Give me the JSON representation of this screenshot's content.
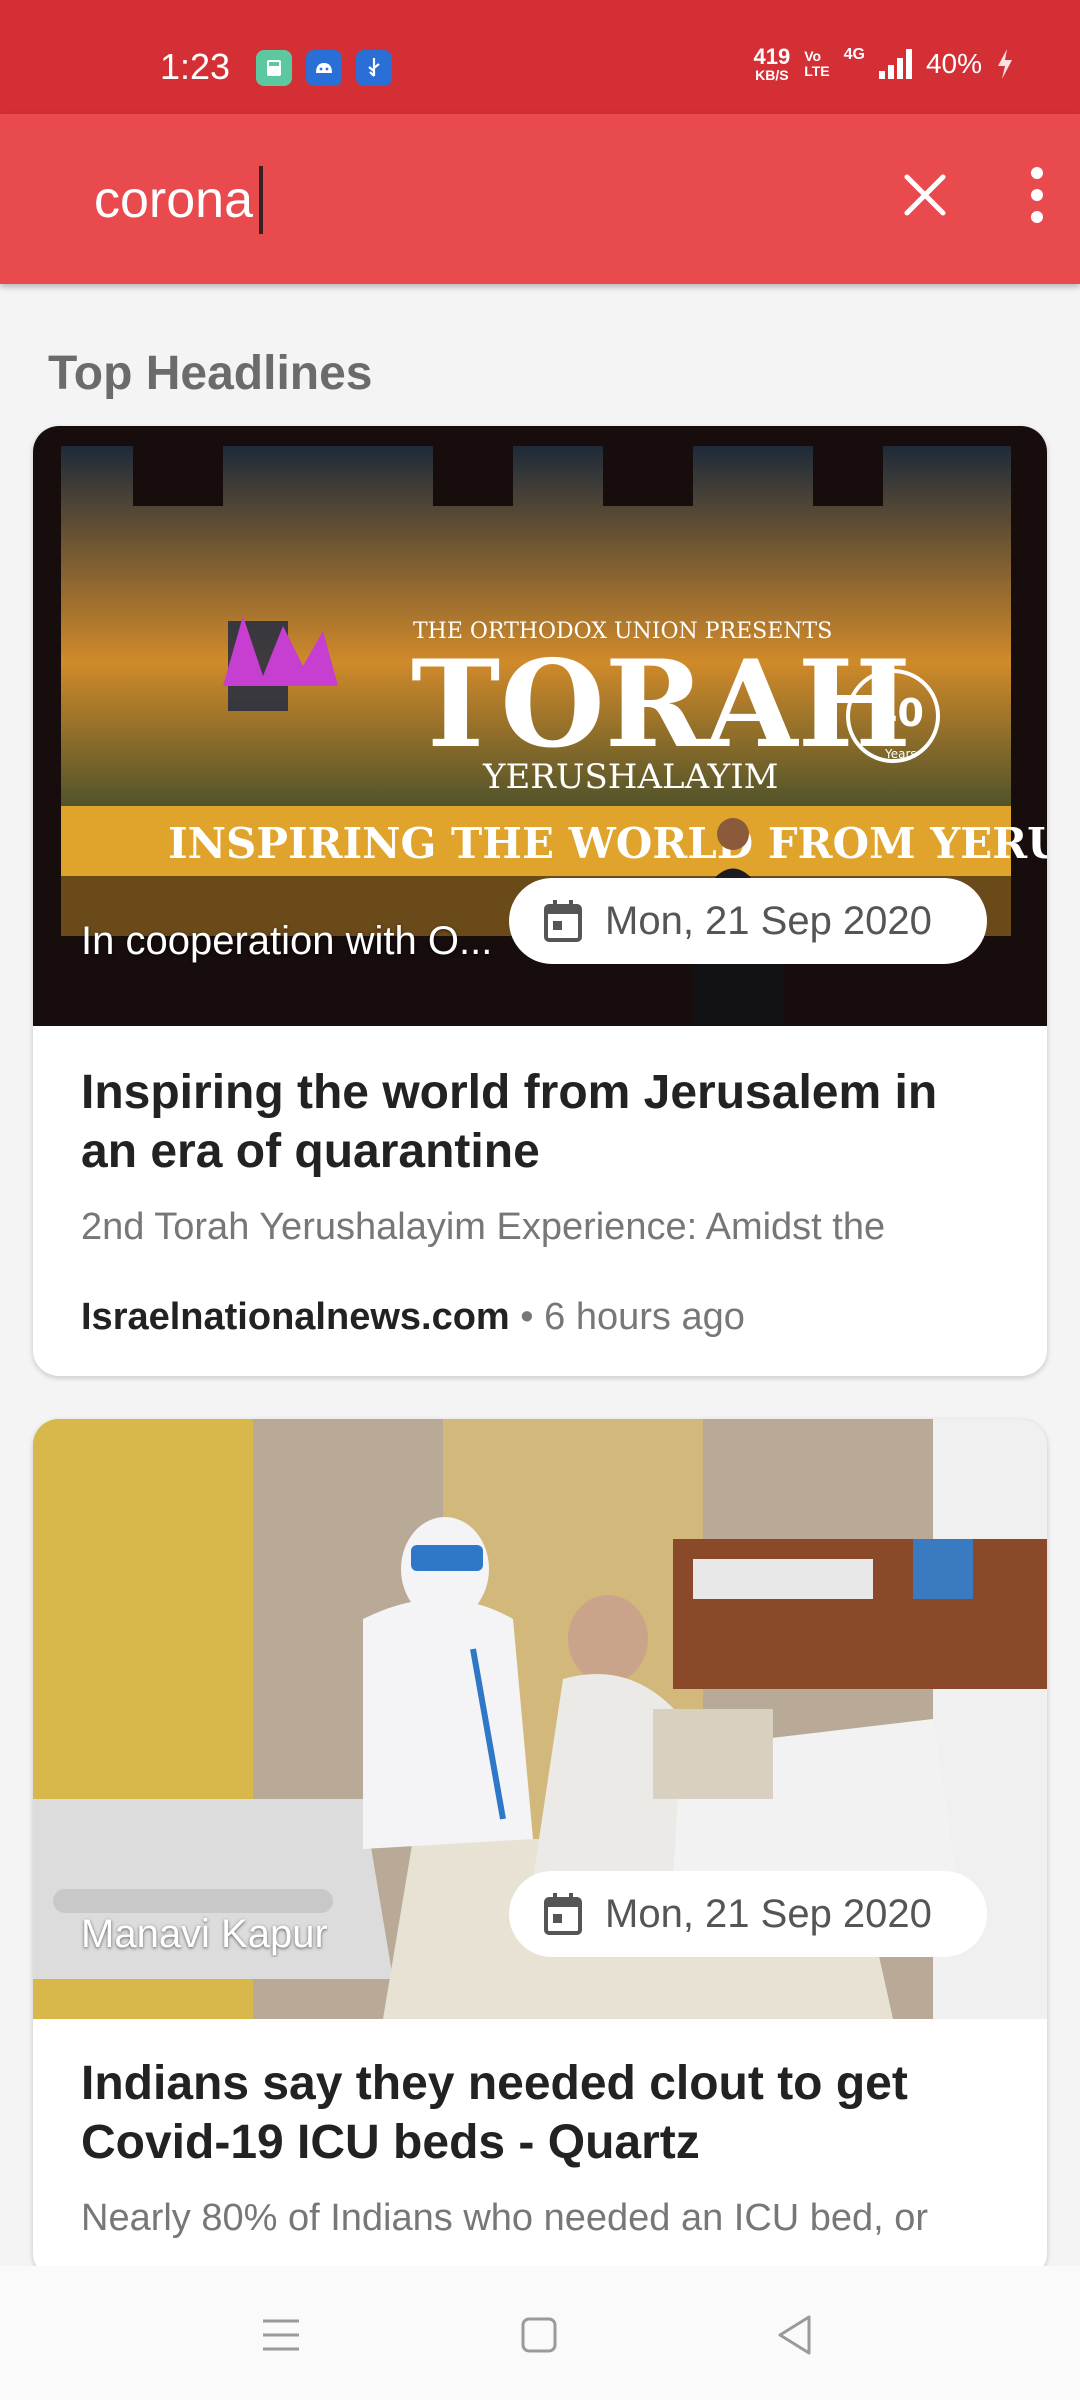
{
  "status_bar": {
    "time": "1:23",
    "net_speed_value": "419",
    "net_speed_unit": "KB/S",
    "volte_top": "Vo",
    "volte_bottom": "LTE",
    "network": "4G",
    "battery": "40%",
    "colors": {
      "background": "#d32f35"
    },
    "icons": [
      "calculator-icon",
      "android-icon",
      "usb-icon",
      "signal-icon",
      "charging-icon"
    ]
  },
  "search": {
    "query": "corona",
    "colors": {
      "background": "#e84a4d"
    },
    "icons": [
      "close-icon",
      "more-vert-icon"
    ]
  },
  "section_title": "Top Headlines",
  "articles": [
    {
      "author": "In cooperation with O...",
      "date": "Mon, 21 Sep 2020",
      "title": "Inspiring the world from Jerusalem in an era of quarantine",
      "description": "2nd Torah Yerushalayim Experience: Amidst the",
      "source": "Israelnationalnews.com",
      "separator": "•",
      "time_ago": "6 hours ago",
      "image_text": {
        "presents": "THE ORTHODOX UNION PRESENTS",
        "logo": "TORAH",
        "subtitle": "YERUSHALAYIM",
        "banner": "INSPIRING THE WORLD FROM YERUSHALAYIM",
        "anniversary": "40",
        "years": "Years"
      }
    },
    {
      "author": "Manavi Kapur",
      "date": "Mon, 21 Sep 2020",
      "title": "Indians say they needed clout to get Covid-19 ICU beds - Quartz",
      "description": "Nearly 80% of Indians who needed an ICU bed, or"
    }
  ],
  "nav_bar": {
    "icons": [
      "menu-icon",
      "home-square-icon",
      "back-triangle-icon"
    ]
  }
}
